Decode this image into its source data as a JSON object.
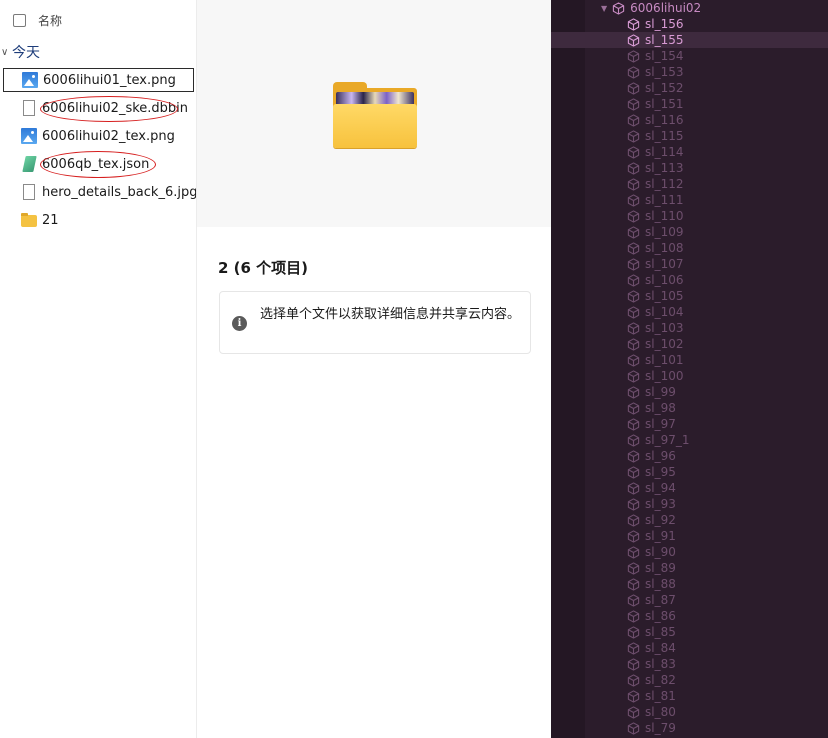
{
  "file_list": {
    "header": {
      "column_name": "名称"
    },
    "group": {
      "label": "今天"
    },
    "files": [
      {
        "name": "6006lihui01_tex.png",
        "icon": "image-file-icon",
        "selected": true
      },
      {
        "name": "6006lihui02_ske.dbbin",
        "icon": "blank-file-icon",
        "selected": false
      },
      {
        "name": "6006lihui02_tex.png",
        "icon": "image-file-icon",
        "selected": false
      },
      {
        "name": "6006qb_tex.json",
        "icon": "json-file-icon",
        "selected": false
      },
      {
        "name": "hero_details_back_6.jpg",
        "icon": "blank-file-icon",
        "selected": false
      },
      {
        "name": "21",
        "icon": "folder-icon",
        "selected": false
      }
    ]
  },
  "details": {
    "selection_count": "2 (6 个项目)",
    "info_message": "选择单个文件以获取详细信息并共享云内容。"
  },
  "hierarchy": {
    "parent": "6006lihui02",
    "nodes": [
      "sl_156",
      "sl_155",
      "sl_154",
      "sl_153",
      "sl_152",
      "sl_151",
      "sl_116",
      "sl_115",
      "sl_114",
      "sl_113",
      "sl_112",
      "sl_111",
      "sl_110",
      "sl_109",
      "sl_108",
      "sl_107",
      "sl_106",
      "sl_105",
      "sl_104",
      "sl_103",
      "sl_102",
      "sl_101",
      "sl_100",
      "sl_99",
      "sl_98",
      "sl_97",
      "sl_97_1",
      "sl_96",
      "sl_95",
      "sl_94",
      "sl_93",
      "sl_92",
      "sl_91",
      "sl_90",
      "sl_89",
      "sl_88",
      "sl_87",
      "sl_86",
      "sl_85",
      "sl_84",
      "sl_83",
      "sl_82",
      "sl_81",
      "sl_80",
      "sl_79"
    ],
    "active_node": "sl_156",
    "selected_node": "sl_155"
  },
  "colors": {
    "annotation": "#d61f1f",
    "hierarchy_bg": "#2b1c2b",
    "hierarchy_text": "#6d4e6c",
    "hierarchy_active": "#d89bd4"
  }
}
